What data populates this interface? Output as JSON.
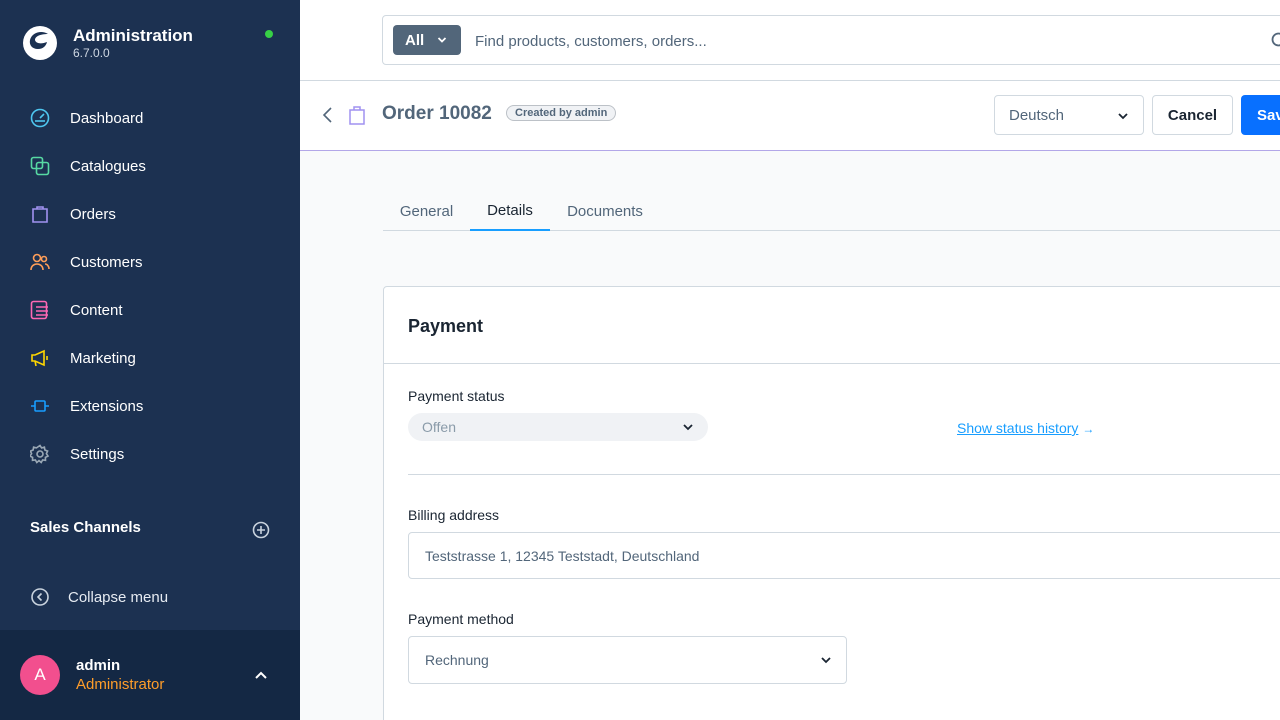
{
  "brand": {
    "title": "Administration",
    "version": "6.7.0.0",
    "status_color": "#37d046"
  },
  "nav": {
    "items": [
      {
        "label": "Dashboard",
        "icon": "dashboard-icon",
        "color": "#4ec7f0"
      },
      {
        "label": "Catalogues",
        "icon": "catalogue-icon",
        "color": "#57d9a3"
      },
      {
        "label": "Orders",
        "icon": "orders-icon",
        "color": "#a092f0"
      },
      {
        "label": "Customers",
        "icon": "customers-icon",
        "color": "#ff9e58"
      },
      {
        "label": "Content",
        "icon": "content-icon",
        "color": "#ff68b4"
      },
      {
        "label": "Marketing",
        "icon": "marketing-icon",
        "color": "#ffd700"
      },
      {
        "label": "Extensions",
        "icon": "extensions-icon",
        "color": "#189eff"
      },
      {
        "label": "Settings",
        "icon": "settings-icon",
        "color": "#9aa8b5"
      }
    ],
    "sales_channels_label": "Sales Channels",
    "collapse_label": "Collapse menu"
  },
  "user": {
    "initial": "A",
    "name": "admin",
    "role": "Administrator"
  },
  "search": {
    "type_label": "All",
    "placeholder": "Find products, customers, orders..."
  },
  "smartbar": {
    "title": "Order 10082",
    "badge": "Created by admin",
    "language": "Deutsch",
    "cancel_label": "Cancel",
    "save_label": "Save"
  },
  "tabs": [
    {
      "label": "General",
      "active": false
    },
    {
      "label": "Details",
      "active": true
    },
    {
      "label": "Documents",
      "active": false
    }
  ],
  "payment": {
    "title": "Payment",
    "status_label": "Payment status",
    "status_value": "Offen",
    "history_link": "Show status history",
    "billing_label": "Billing address",
    "billing_value": "Teststrasse 1, 12345 Teststadt, Deutschland",
    "method_label": "Payment method",
    "method_value": "Rechnung"
  },
  "colors": {
    "sidebar_bg": "#1c3151",
    "primary": "#0870ff",
    "link": "#189eff",
    "role": "#ff9d2a"
  }
}
